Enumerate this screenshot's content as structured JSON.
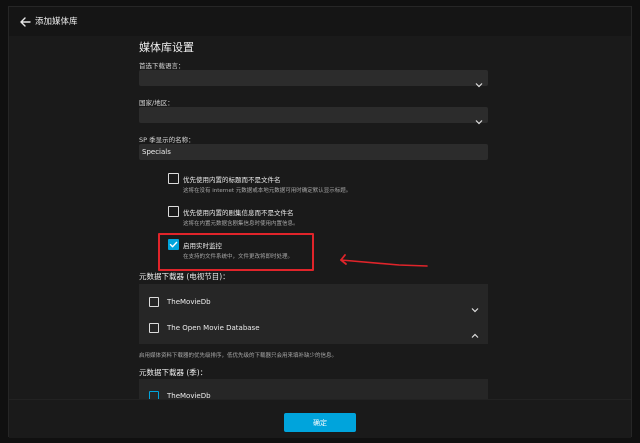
{
  "header": {
    "title": "添加媒体库"
  },
  "section": {
    "title": "媒体库设置"
  },
  "fields": {
    "language_label": "首选下载语言：",
    "country_label": "国家/地区：",
    "sp_label": "SP 季显示的名称：",
    "sp_value": "Specials"
  },
  "checkboxes": [
    {
      "label": "优先使用内置的标题而不是文件名",
      "desc": "这将在没有 internet 元数据或本地元数据可用时确定默认显示标题。",
      "checked": false
    },
    {
      "label": "优先使用内置的剧集信息而不是文件名",
      "desc": "这将在内置元数据含剧集信息时使用内置信息。",
      "checked": false
    },
    {
      "label": "启用实时监控",
      "desc": "在支持的文件系统中，文件更改将即时处理。",
      "checked": true
    }
  ],
  "downloaders_tv": {
    "heading": "元数据下载器 (电视节目)：",
    "items": [
      {
        "label": "TheMovieDb",
        "chevron": "chevron-down-icon"
      },
      {
        "label": "The Open Movie Database",
        "chevron": "chevron-up-icon"
      }
    ],
    "hint": "启用媒体资料下载器的优先级排序，低优先级的下载器只会用来填补缺少的信息。"
  },
  "downloaders_season": {
    "heading": "元数据下载器 (季)：",
    "items": [
      {
        "label": "TheMovieDb"
      }
    ]
  },
  "footer": {
    "ok_label": "确定"
  },
  "colors": {
    "accent": "#00a4dc",
    "highlight": "#e0242a",
    "background": "#1a1a1a"
  }
}
